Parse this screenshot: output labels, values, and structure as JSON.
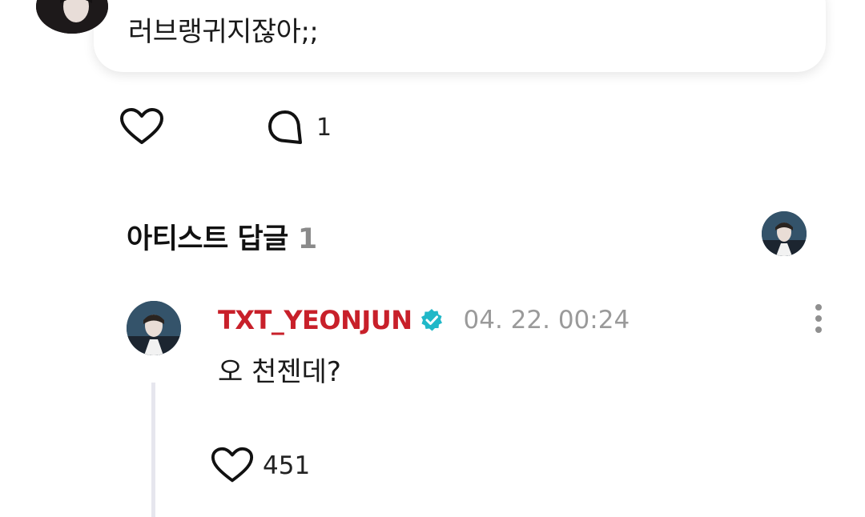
{
  "post": {
    "text": "러브랭귀지잖아;;",
    "comment_count": "1"
  },
  "artist_replies": {
    "title": "아티스트 답글",
    "count": "1"
  },
  "reply": {
    "author": "TXT_YEONJUN",
    "timestamp": "04. 22. 00:24",
    "text": "오 천젠데?",
    "like_count": "451"
  },
  "colors": {
    "author": "#c8202a",
    "verified": "#21b8c8",
    "muted": "#9a9a9a"
  },
  "icons": {
    "like": "heart-icon",
    "comment": "speech-bubble-icon",
    "verified": "verified-badge-icon",
    "more": "more-vertical-icon"
  }
}
